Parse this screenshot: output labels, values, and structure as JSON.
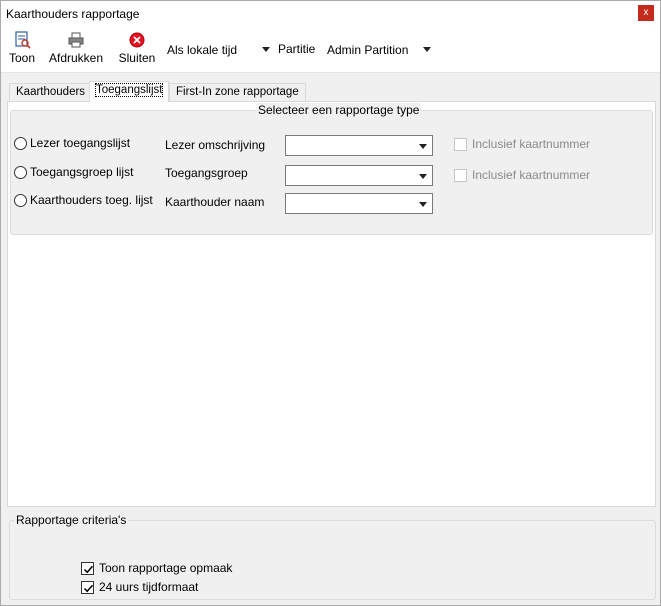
{
  "window": {
    "title": "Kaarthouders rapportage",
    "close_glyph": "x"
  },
  "toolbar": {
    "show_label": "Toon",
    "print_label": "Afdrukken",
    "close_label": "Sluiten",
    "time_select": "Als lokale tijd",
    "partition_label": "Partitie",
    "partition_select": "Admin Partition",
    "accent_close": "#e81123"
  },
  "tabs": [
    {
      "label": "Kaarthouders"
    },
    {
      "label": "Toegangslijst"
    },
    {
      "label": "First-In zone rapportage"
    }
  ],
  "report_type": {
    "legend": "Selecteer een rapportage type",
    "options": [
      {
        "radio": "Lezer toegangslijst",
        "field_label": "Lezer omschrijving",
        "checkbox": "Inclusief kaartnummer"
      },
      {
        "radio": "Toegangsgroep lijst",
        "field_label": "Toegangsgroep",
        "checkbox": "Inclusief kaartnummer"
      },
      {
        "radio": "Kaarthouders toeg. lijst",
        "field_label": "Kaarthouder naam"
      }
    ]
  },
  "criteria": {
    "legend": "Rapportage criteria's",
    "show_layout": "Toon rapportage opmaak",
    "time_24h": "24 uurs tijdformaat",
    "show_layout_checked": true,
    "time_24h_checked": true
  }
}
